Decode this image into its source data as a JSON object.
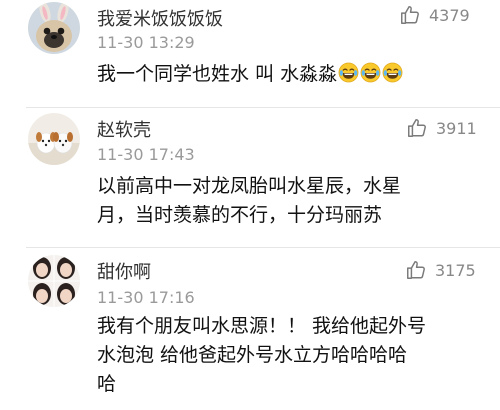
{
  "comments": [
    {
      "username": "我爱米饭饭饭饭",
      "time": "11-30 13:29",
      "likes": "4379",
      "text": "我一个同学也姓水 叫 水淼淼",
      "emoji_count": 3,
      "emoji_name": "laughing-tears-icon",
      "avatar": "pug-with-bunny-ears-icon"
    },
    {
      "username": "赵软壳",
      "time": "11-30 17:43",
      "likes": "3911",
      "text_lines": [
        "以前高中一对龙凤胎叫水星辰，水星",
        "月，当时羡慕的不行，十分玛丽苏"
      ],
      "avatar": "two-puppies-icon"
    },
    {
      "username": "甜你啊",
      "time": "11-30 17:16",
      "likes": "3175",
      "text_lines": [
        "我有个朋友叫水思源！！ 我给他起外号",
        "水泡泡 给他爸起外号水立方哈哈哈哈",
        "哈"
      ],
      "avatar": "girl-photo-grid-icon"
    }
  ],
  "colors": {
    "username": "#333333",
    "time": "#9a9a9a",
    "like": "#888888",
    "divider": "#e6e6e6"
  }
}
